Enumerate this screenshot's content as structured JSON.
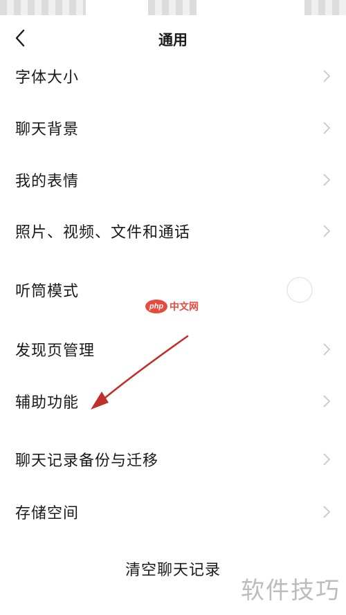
{
  "nav": {
    "title": "通用"
  },
  "settings": [
    {
      "label": "字体大小",
      "control": "chevron"
    },
    {
      "label": "聊天背景",
      "control": "chevron"
    },
    {
      "label": "我的表情",
      "control": "chevron"
    },
    {
      "label": "照片、视频、文件和通话",
      "control": "chevron"
    },
    {
      "label": "听筒模式",
      "control": "toggle",
      "toggle_on": false
    },
    {
      "label": "发现页管理",
      "control": "chevron"
    },
    {
      "label": "辅助功能",
      "control": "chevron"
    },
    {
      "label": "聊天记录备份与迁移",
      "control": "chevron"
    },
    {
      "label": "存储空间",
      "control": "chevron"
    }
  ],
  "clear_button": {
    "label": "清空聊天记录"
  },
  "watermarks": {
    "php_logo_text": "php",
    "php_site_text": "中文网",
    "corner_text": "软件技巧"
  },
  "colors": {
    "arrow": "#c0302a",
    "chevron": "#c8c8c8",
    "php_brand": "#e64b3c"
  }
}
